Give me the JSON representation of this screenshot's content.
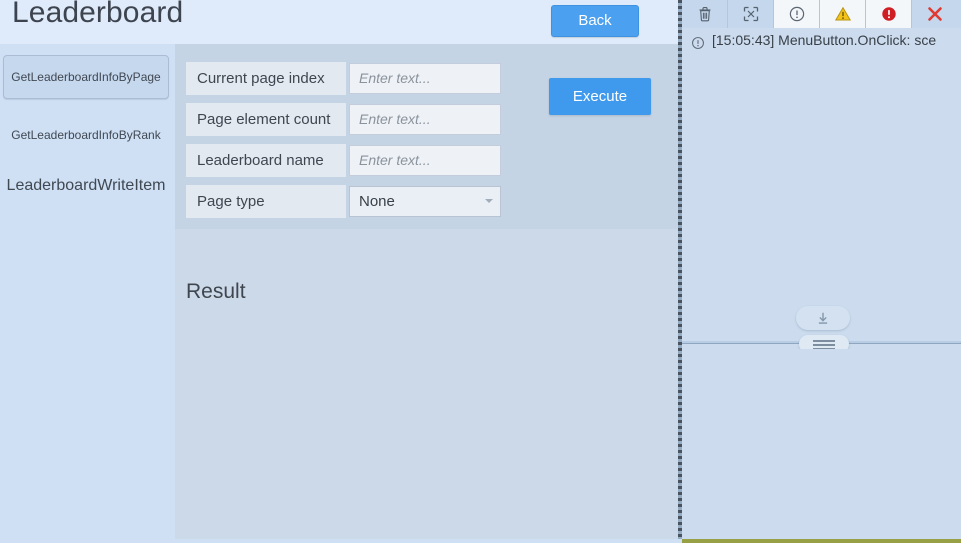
{
  "header": {
    "title": "Leaderboard",
    "back_label": "Back"
  },
  "sidebar": {
    "items": [
      {
        "label": "GetLeaderboardInfoByPage",
        "selected": true
      },
      {
        "label": "GetLeaderboardInfoByRank",
        "selected": false
      },
      {
        "label": "LeaderboardWriteItem",
        "selected": false
      }
    ]
  },
  "form": {
    "rows": [
      {
        "label": "Current page index",
        "type": "text",
        "value": "",
        "placeholder": "Enter text..."
      },
      {
        "label": "Page element count",
        "type": "text",
        "value": "",
        "placeholder": "Enter text..."
      },
      {
        "label": "Leaderboard name",
        "type": "text",
        "value": "",
        "placeholder": "Enter text..."
      },
      {
        "label": "Page type",
        "type": "select",
        "value": "None",
        "options": [
          "None"
        ]
      }
    ],
    "execute_label": "Execute"
  },
  "result": {
    "title": "Result",
    "body": ""
  },
  "console": {
    "toolbar": [
      {
        "icon": "trash-icon",
        "active": true,
        "tooltip": "Clear"
      },
      {
        "icon": "collapse-icon",
        "active": true,
        "tooltip": "Collapse"
      },
      {
        "icon": "info-circle-icon",
        "active": false,
        "tooltip": "Info"
      },
      {
        "icon": "warning-triangle-icon",
        "active": false,
        "tooltip": "Warnings"
      },
      {
        "icon": "error-circle-icon",
        "active": false,
        "tooltip": "Errors"
      },
      {
        "icon": "close-icon",
        "active": true,
        "tooltip": "Close"
      }
    ],
    "log_lines": [
      {
        "icon": "info-circle-icon",
        "text": "[15:05:43] MenuButton.OnClick: sce"
      }
    ],
    "scroll_to_bottom_icon": "download-arrow-icon",
    "splitter_icon": "grip-handle-icon"
  },
  "colors": {
    "accent_blue": "#4ba0ef",
    "panel_blue": "#ccd9e8",
    "sidebar_blue": "#cfe0f5",
    "console_blue": "#ccdcee",
    "warning_yellow": "#f0c419",
    "error_red": "#cf2027",
    "close_red": "#e03a32",
    "bottom_strip": "#97a045"
  }
}
